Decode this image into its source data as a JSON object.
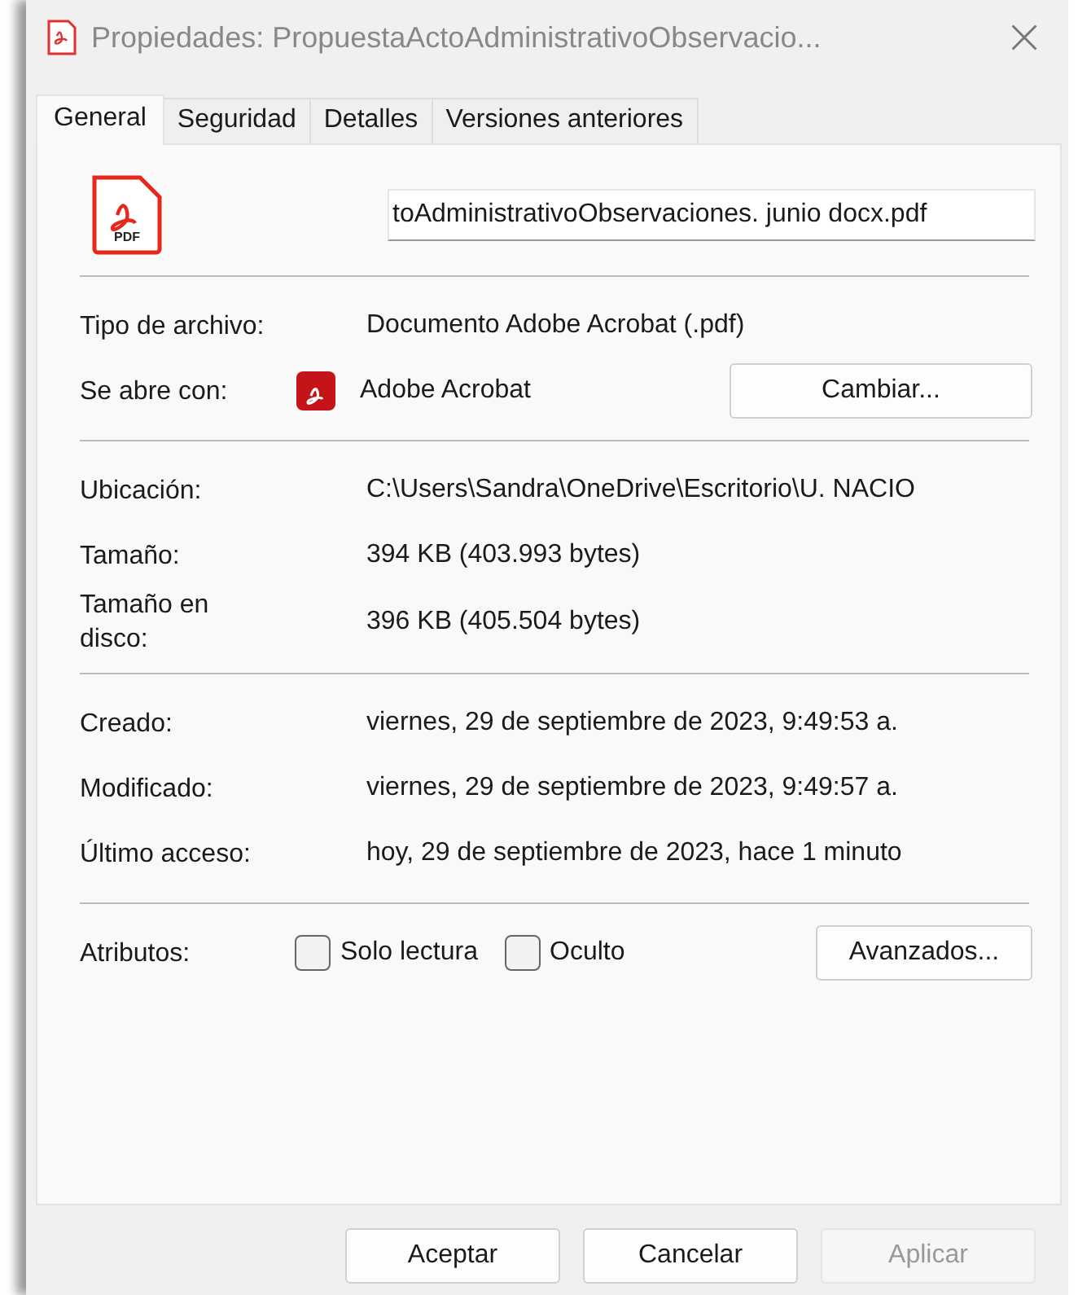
{
  "window": {
    "title": "Propiedades: PropuestaActoAdministrativoObservacio..."
  },
  "tabs": [
    {
      "label": "General",
      "selected": true
    },
    {
      "label": "Seguridad",
      "selected": false
    },
    {
      "label": "Detalles",
      "selected": false
    },
    {
      "label": "Versiones anteriores",
      "selected": false
    }
  ],
  "file_icon": {
    "label": "PDF"
  },
  "file_name": {
    "value": "toAdministrativoObservaciones. junio docx.pdf"
  },
  "sections": [
    {
      "rows": [
        {
          "kind": "text",
          "label": "Tipo de archivo:",
          "value": "Documento Adobe Acrobat (.pdf)"
        },
        {
          "kind": "app",
          "label": "Se abre con:",
          "value": "Adobe Acrobat",
          "button": "Cambiar..."
        }
      ]
    },
    {
      "rows": [
        {
          "kind": "text",
          "label": "Ubicación:",
          "value": "C:\\Users\\Sandra\\OneDrive\\Escritorio\\U. NACIO"
        },
        {
          "kind": "text",
          "label": "Tamaño:",
          "value": "394 KB (403.993 bytes)"
        },
        {
          "kind": "text",
          "label": "Tamaño en disco:",
          "value": "396 KB (405.504 bytes)"
        }
      ]
    },
    {
      "rows": [
        {
          "kind": "text",
          "label": "Creado:",
          "value": "viernes, 29 de septiembre de 2023, 9:49:53 a."
        },
        {
          "kind": "text",
          "label": "Modificado:",
          "value": "viernes, 29 de septiembre de 2023, 9:49:57 a."
        },
        {
          "kind": "text",
          "label": "Último acceso:",
          "value": "hoy, 29 de septiembre de 2023, hace 1 minuto"
        }
      ]
    },
    {
      "rows": [
        {
          "kind": "checks",
          "label": "Atributos:",
          "checks": [
            {
              "label": "Solo lectura",
              "checked": false
            },
            {
              "label": "Oculto",
              "checked": false
            }
          ],
          "button": "Avanzados..."
        }
      ]
    }
  ],
  "buttons": [
    {
      "label": "Aceptar",
      "disabled": false
    },
    {
      "label": "Cancelar",
      "disabled": false
    },
    {
      "label": "Aplicar",
      "disabled": true
    }
  ]
}
